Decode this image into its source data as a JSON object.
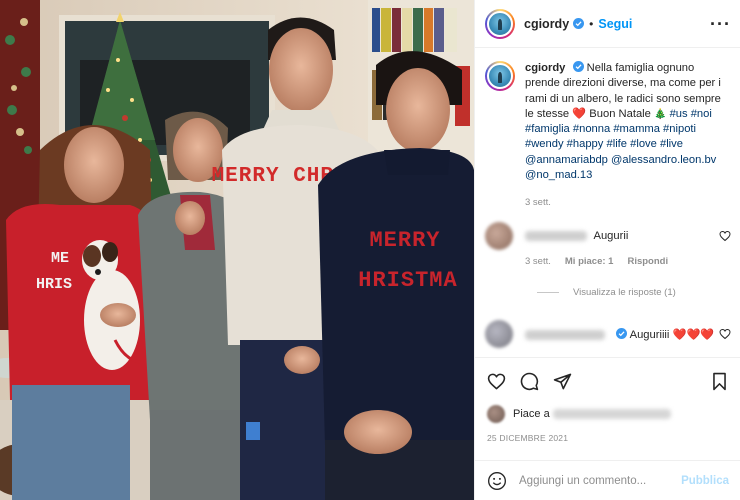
{
  "post": {
    "username": "cgiordy",
    "follow_label": "Segui",
    "separator": "•",
    "more_icon": "more-horizontal-icon",
    "photo_sweater_1": "MERRY CHRISTM",
    "photo_sweater_2": "MERRY HRISTMA",
    "photo_sweater_3": "ME HRIS"
  },
  "caption": {
    "username": "cgiordy",
    "text_1": "Nella famiglia ognuno prende direzioni diverse, ma come per i rami di un albero, le radici sono sempre le stesse ",
    "heart": "❤️",
    "text_2": " Buon Natale ",
    "tree": "🎄",
    "hashtags": "#us #noi #famiglia #nonna #mamma #nipoti #wendy #happy #life #love #live",
    "mentions": "@annamariabdp @alessandro.leon.bv @no_mad.13",
    "time": "3 sett."
  },
  "comments": [
    {
      "text": "Augurii",
      "time": "3 sett.",
      "likes": "Mi piace: 1",
      "reply": "Rispondi",
      "view_replies": "Visualizza le risposte (1)"
    },
    {
      "text": "Auguriiii ",
      "hearts": "❤️❤️❤️"
    }
  ],
  "actions": {
    "likes_prefix": "Piace a",
    "date": "25 DICEMBRE 2021"
  },
  "add_comment": {
    "placeholder": "Aggiungi un commento...",
    "publish": "Pubblica"
  },
  "colors": {
    "link": "#0095f6",
    "hashtag": "#00376b",
    "heart": "#ed4956",
    "muted": "#8e8e8e"
  }
}
